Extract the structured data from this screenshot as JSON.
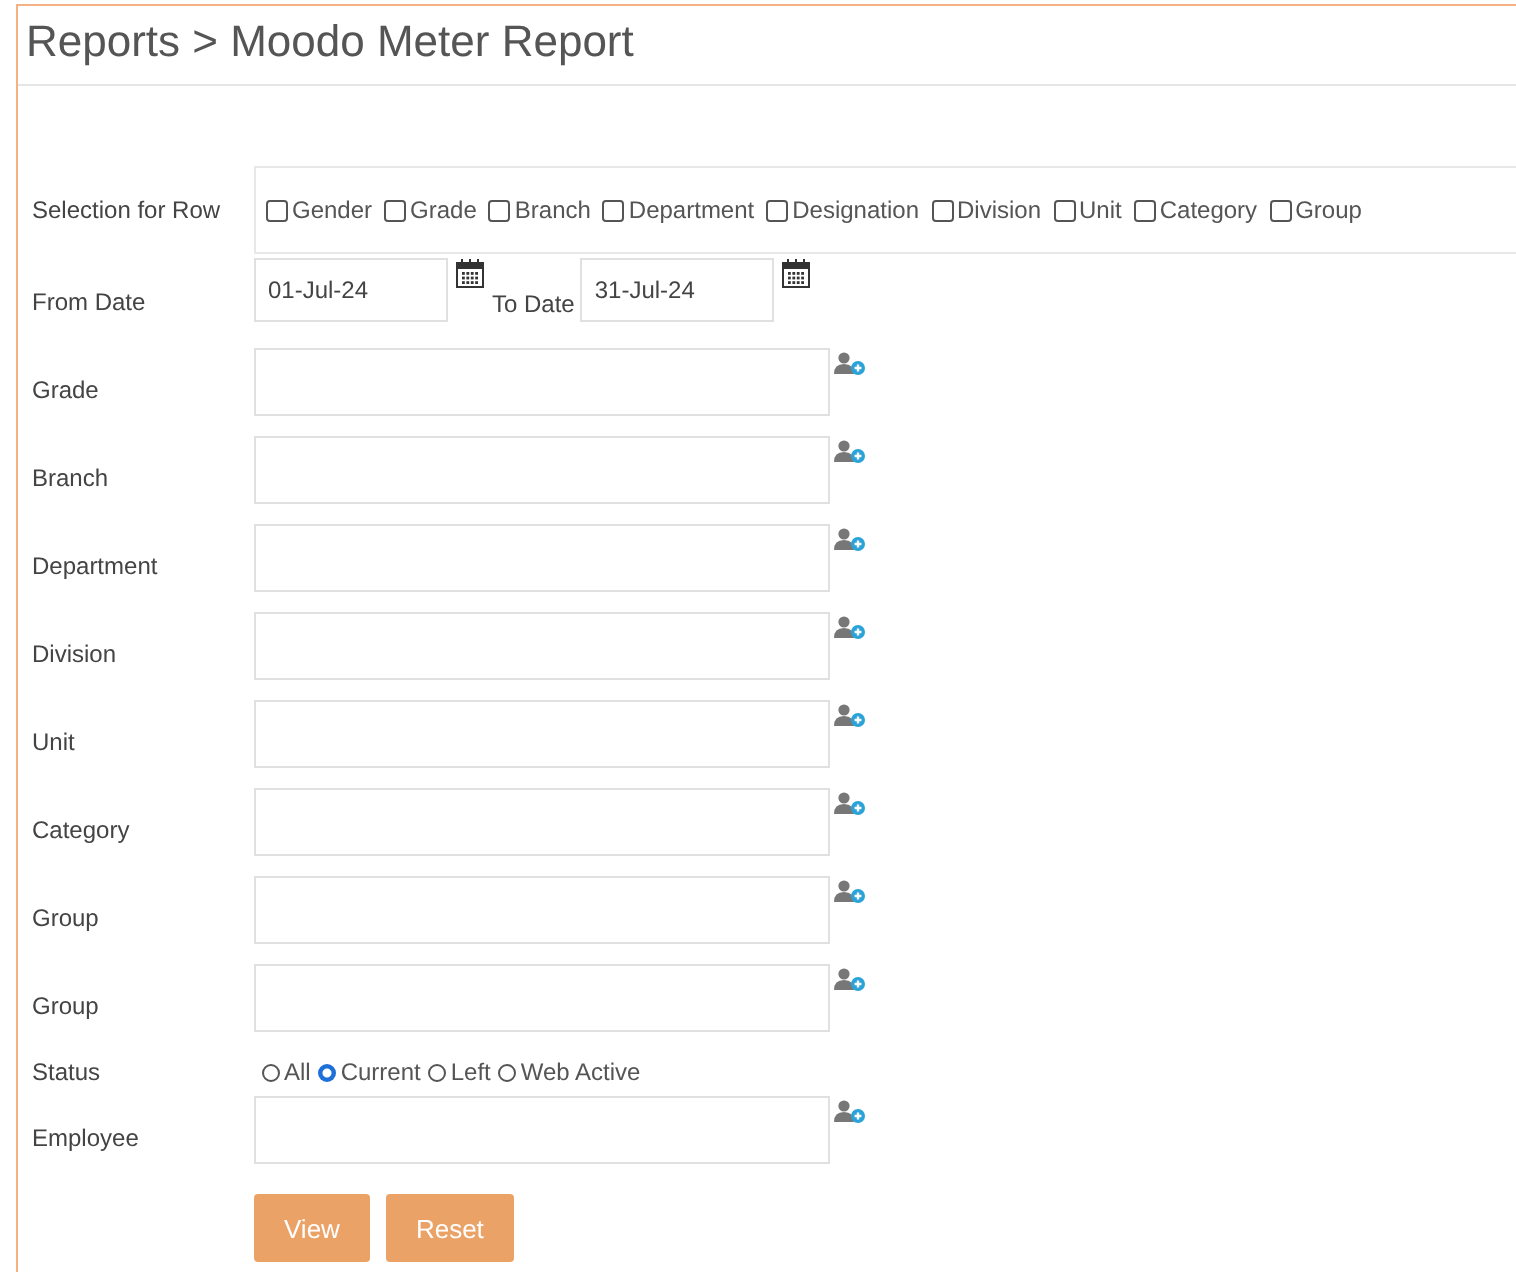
{
  "title": "Reports > Moodo Meter Report",
  "selection": {
    "label": "Selection for Row",
    "options": [
      {
        "label": "Gender",
        "checked": false
      },
      {
        "label": "Grade",
        "checked": false
      },
      {
        "label": "Branch",
        "checked": false
      },
      {
        "label": "Department",
        "checked": false
      },
      {
        "label": "Designation",
        "checked": false
      },
      {
        "label": "Division",
        "checked": false
      },
      {
        "label": "Unit",
        "checked": false
      },
      {
        "label": "Category",
        "checked": false
      },
      {
        "label": "Group",
        "checked": false
      }
    ]
  },
  "date_row": {
    "from_label": "From Date",
    "from_value": "01-Jul-24",
    "to_label": "To Date",
    "to_value": "31-Jul-24"
  },
  "fields": [
    {
      "label": "Grade"
    },
    {
      "label": "Branch"
    },
    {
      "label": "Department"
    },
    {
      "label": "Division"
    },
    {
      "label": "Unit"
    },
    {
      "label": "Category"
    },
    {
      "label": "Group"
    },
    {
      "label": "Group"
    }
  ],
  "status": {
    "label": "Status",
    "options": [
      {
        "label": "All",
        "selected": false
      },
      {
        "label": "Current",
        "selected": true
      },
      {
        "label": "Left",
        "selected": false
      },
      {
        "label": "Web Active",
        "selected": false
      }
    ]
  },
  "employee": {
    "label": "Employee"
  },
  "buttons": [
    "View",
    "Reset"
  ]
}
